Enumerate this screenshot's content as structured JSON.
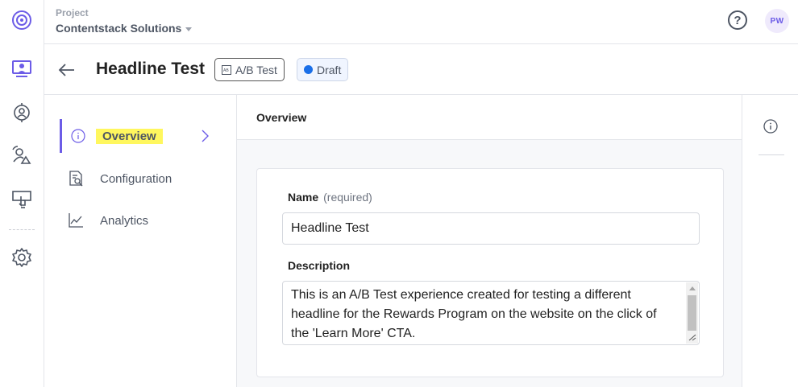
{
  "topbar": {
    "project_label": "Project",
    "project_name": "Contentstack Solutions",
    "help_icon": "?",
    "avatar_initials": "PW"
  },
  "header": {
    "title": "Headline Test",
    "type_badge": "A/B Test",
    "status_badge": "Draft",
    "status_color": "#1a6fe8"
  },
  "leftnav": {
    "items": [
      {
        "label": "Overview",
        "icon": "info-icon",
        "active": true
      },
      {
        "label": "Configuration",
        "icon": "configuration-icon",
        "active": false
      },
      {
        "label": "Analytics",
        "icon": "analytics-chart-icon",
        "active": false
      }
    ]
  },
  "main": {
    "section_title": "Overview",
    "name_label": "Name",
    "name_required": "(required)",
    "name_value": "Headline Test",
    "description_label": "Description",
    "description_value": "This is an A/B Test experience created for testing a different headline for the Rewards Program on the website on the click of the 'Learn More' CTA."
  },
  "colors": {
    "accent": "#6c5ce7",
    "highlight": "#fff75e"
  }
}
